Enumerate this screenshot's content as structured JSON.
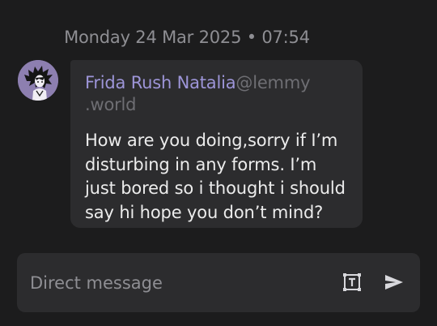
{
  "timestamp": "Monday 24 Mar 2025 • 07:54",
  "message": {
    "sender_name": "Frida Rush Natalia",
    "sender_instance_line1": "@lemmy",
    "sender_instance_line2": ".world",
    "body": "How are you doing,sorry if I’m disturbing in any forms. I’m just bored so i thought i should say hi hope you don’t mind?"
  },
  "composer": {
    "placeholder": "Direct message",
    "value": ""
  },
  "icons": {
    "format": "text-format-icon",
    "send": "send-icon",
    "avatar": "user-avatar"
  },
  "colors": {
    "background": "#1c1c1d",
    "bubble": "#2c2c2e",
    "sender_name": "#9d95d8",
    "avatar_bg": "#8d7fb0"
  }
}
